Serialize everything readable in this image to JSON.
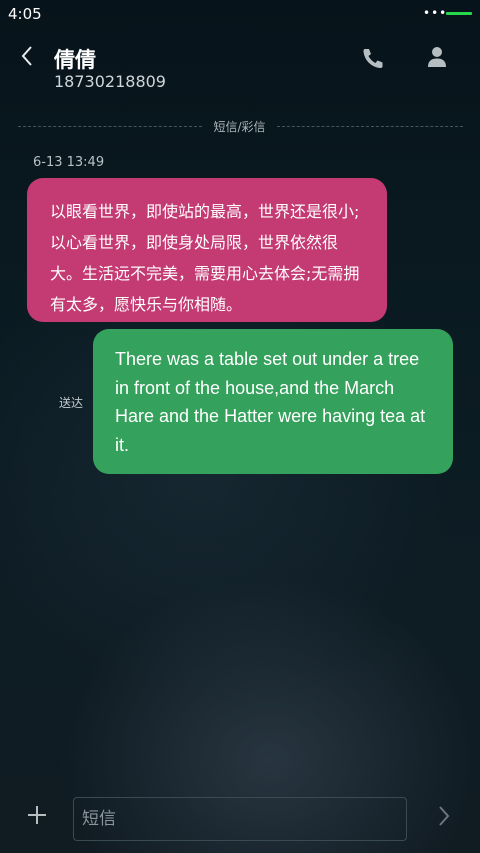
{
  "status_bar": {
    "time": "4:05",
    "signal_dots": "•••"
  },
  "header": {
    "contact_name": "倩倩",
    "contact_number": "18730218809"
  },
  "conversation": {
    "divider_label": "短信/彩信",
    "timestamp": "6-13 13:49",
    "messages": [
      {
        "direction": "incoming",
        "text": "以眼看世界，即使站的最高，世界还是很小;以心看世界，即使身处局限，世界依然很大。生活远不完美，需要用心去体会;无需拥有太多，愿快乐与你相随。",
        "color": "#c43a73"
      },
      {
        "direction": "outgoing",
        "text": "There was a table set out under a tree in front of the house,and the March Hare and the Hatter were having tea at it.",
        "status": "送达",
        "color": "#34a25c"
      }
    ]
  },
  "composer": {
    "placeholder": "短信",
    "value": ""
  },
  "icons": [
    "back-icon",
    "phone-icon",
    "person-icon",
    "add-icon",
    "send-icon"
  ]
}
